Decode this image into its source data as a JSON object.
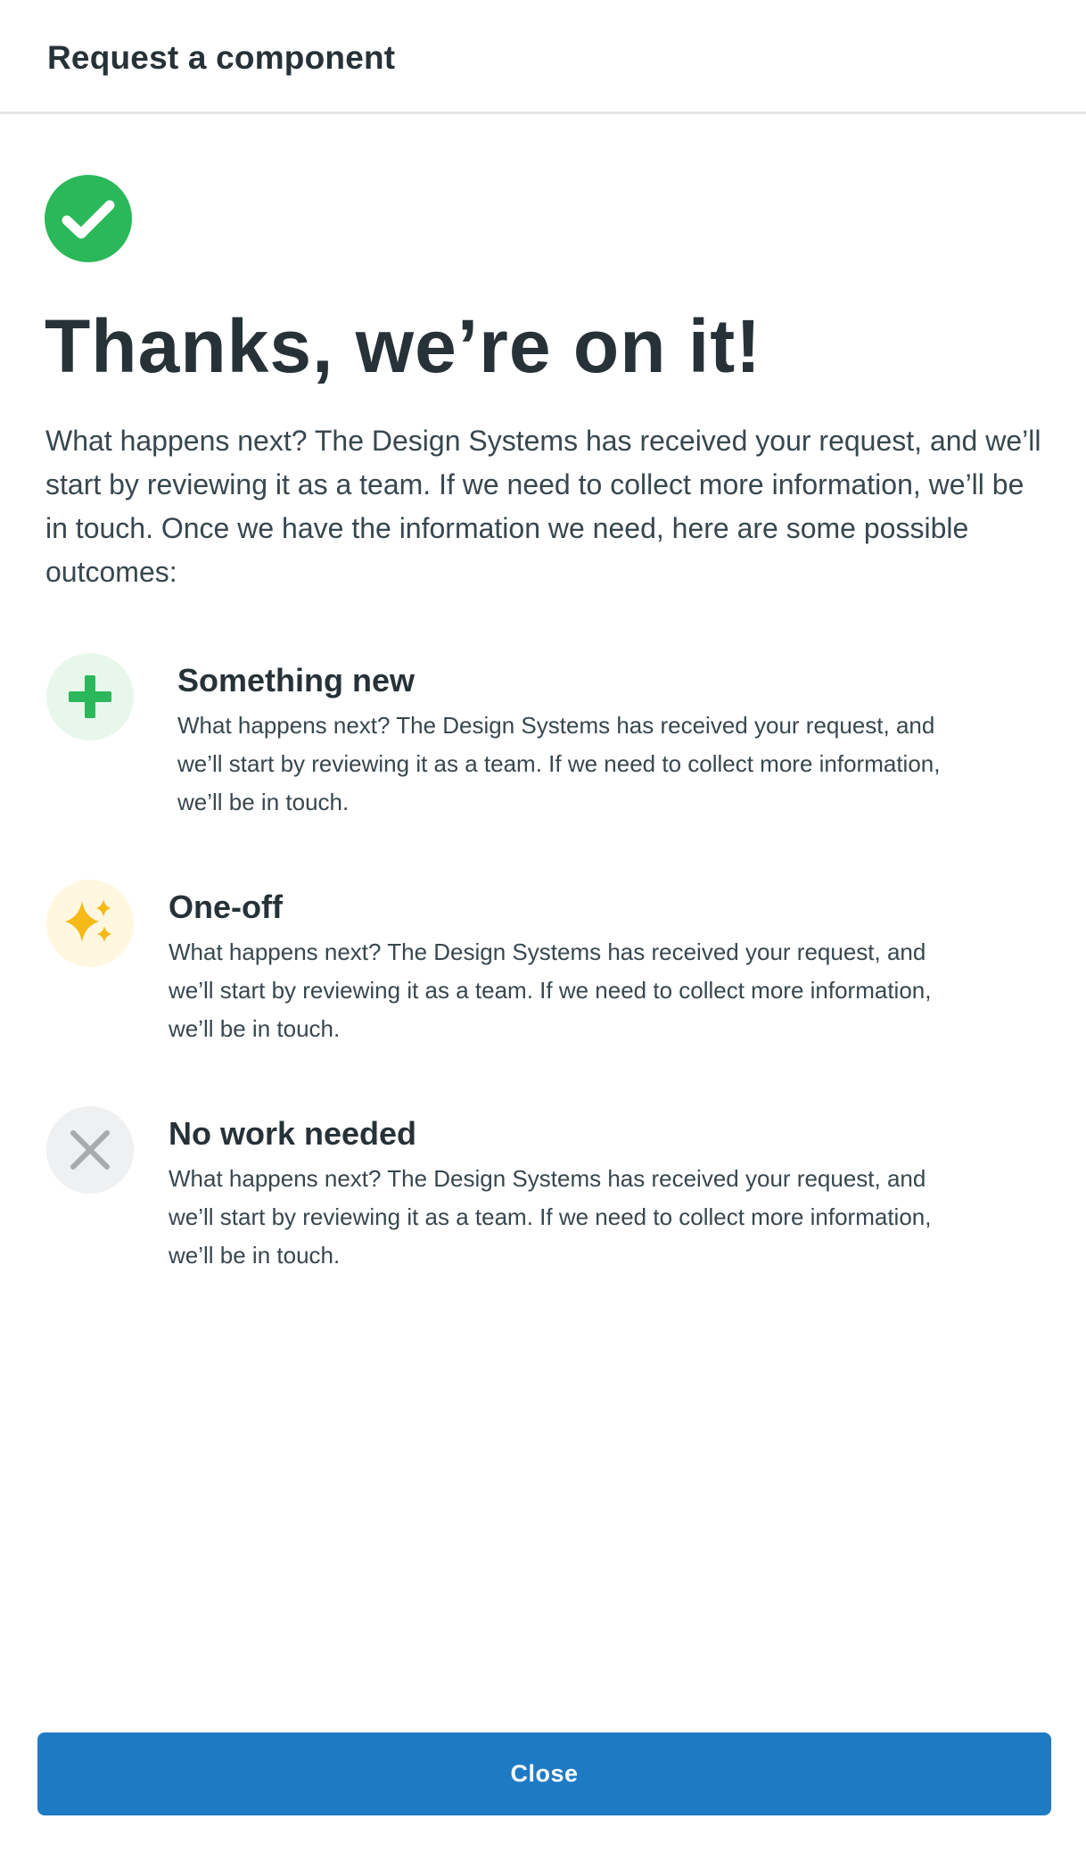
{
  "header": {
    "title": "Request a component"
  },
  "confirmation": {
    "icon": "check-circle-icon",
    "headline": "Thanks, we’re on it!",
    "intro": "What happens next? The Design Systems has received your request, and we’ll start by reviewing it as a team. If we need to collect more information, we’ll be in touch. Once we have the information we need, here are some possible outcomes:"
  },
  "outcomes": [
    {
      "icon": "plus-icon",
      "title": "Something new",
      "description": "What happens next? The Design Systems has received your request, and we’ll start by reviewing it as a team. If we need to collect more information, we’ll be in touch.",
      "icon_color": "#2bb85a",
      "icon_bg": "#e8f7ec"
    },
    {
      "icon": "sparkle-icon",
      "title": "One-off",
      "description": "What happens next? The Design Systems has received your request, and we’ll start by reviewing it as a team. If we need to collect more information, we’ll be in touch.",
      "icon_color": "#f5b918",
      "icon_bg": "#fff7e0"
    },
    {
      "icon": "close-x-icon",
      "title": "No work needed",
      "description": "What happens next? The Design Systems has received your request, and we’ll start by reviewing it as a team. If we need to collect more information, we’ll be in touch.",
      "icon_color": "#a7abae",
      "icon_bg": "#eef0f1"
    }
  ],
  "footer": {
    "close_label": "Close"
  },
  "colors": {
    "accent": "#1f7ac4",
    "success": "#2bb85a",
    "text": "#263238"
  }
}
